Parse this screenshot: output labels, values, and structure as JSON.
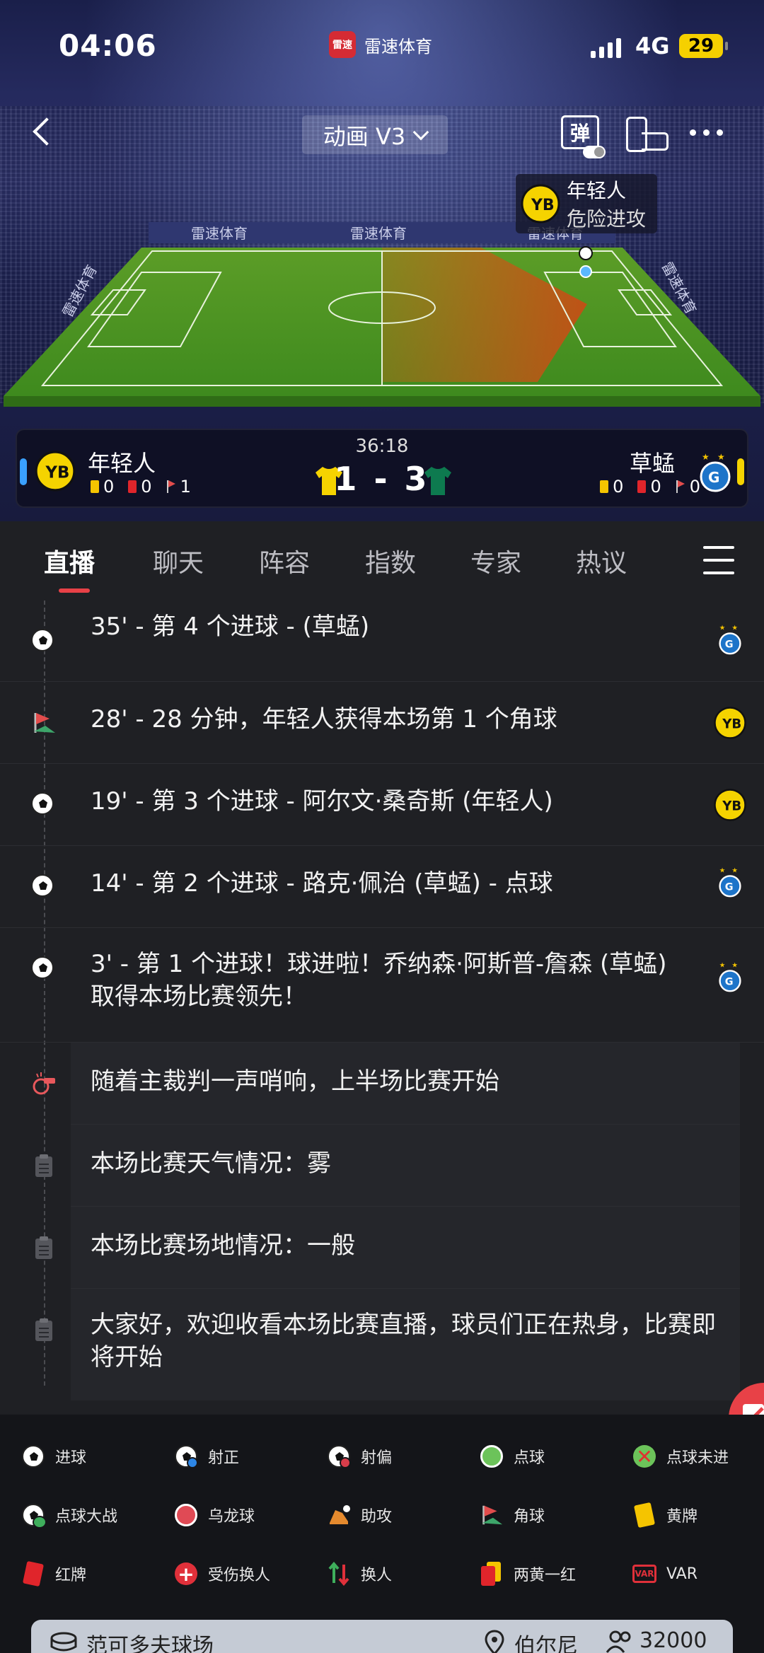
{
  "status_bar": {
    "time": "04:06",
    "app_name": "雷速体育",
    "app_logo_text": "雷速",
    "network": "4G",
    "battery": "29"
  },
  "header": {
    "mode_label": "动画 V3",
    "danmu_label": "弹"
  },
  "event_tip": {
    "team": "年轻人",
    "event": "危险进攻"
  },
  "pitch_ads": [
    "雷速体育",
    "雷速体育",
    "雷速体育",
    "雷速体育",
    "雷速体育"
  ],
  "match": {
    "clock": "36:18",
    "score": "1 - 3",
    "home": {
      "name": "年轻人",
      "yellow": "0",
      "red": "0",
      "corners": "1",
      "color": "#f5d300"
    },
    "away": {
      "name": "草蜢",
      "yellow": "0",
      "red": "0",
      "corners": "0",
      "color": "#0d7a4f"
    }
  },
  "tabs": [
    "直播",
    "聊天",
    "阵容",
    "指数",
    "专家",
    "热议"
  ],
  "feed": [
    {
      "type": "goal",
      "text": "35' - 第 4 个进球 - (草蜢)",
      "team": "away"
    },
    {
      "type": "corner",
      "text": "28' - 28 分钟，年轻人获得本场第 1 个角球",
      "team": "home"
    },
    {
      "type": "goal",
      "text": "19' - 第 3 个进球 - 阿尔文·桑奇斯 (年轻人)",
      "team": "home"
    },
    {
      "type": "goal",
      "text": "14' - 第 2 个进球 - 路克·佩治 (草蜢) - 点球",
      "team": "away"
    },
    {
      "type": "goal",
      "text": "3' - 第 1 个进球！球进啦！乔纳森·阿斯普-詹森 (草蜢) 取得本场比赛领先！",
      "team": "away"
    },
    {
      "type": "whistle",
      "text": "随着主裁判一声哨响，上半场比赛开始"
    },
    {
      "type": "note",
      "text": "本场比赛天气情况：雾"
    },
    {
      "type": "note",
      "text": "本场比赛场地情况：一般"
    },
    {
      "type": "note",
      "text": "大家好，欢迎收看本场比赛直播，球员们正在热身，比赛即将开始"
    }
  ],
  "legend": [
    {
      "icon": "goal-icon",
      "label": "进球"
    },
    {
      "icon": "shot-on-target-icon",
      "label": "射正"
    },
    {
      "icon": "shot-off-target-icon",
      "label": "射偏"
    },
    {
      "icon": "penalty-icon",
      "label": "点球"
    },
    {
      "icon": "penalty-missed-icon",
      "label": "点球未进"
    },
    {
      "icon": "penalty-shootout-icon",
      "label": "点球大战"
    },
    {
      "icon": "own-goal-icon",
      "label": "乌龙球"
    },
    {
      "icon": "assist-icon",
      "label": "助攻"
    },
    {
      "icon": "corner-icon",
      "label": "角球"
    },
    {
      "icon": "yellow-card-icon",
      "label": "黄牌"
    },
    {
      "icon": "red-card-icon",
      "label": "红牌"
    },
    {
      "icon": "injury-sub-icon",
      "label": "受伤换人"
    },
    {
      "icon": "substitution-icon",
      "label": "换人"
    },
    {
      "icon": "second-yellow-red-icon",
      "label": "两黄一红"
    },
    {
      "icon": "var-icon",
      "label": "VAR"
    }
  ],
  "venue": {
    "stadium": "范可多夫球场",
    "city": "伯尔尼",
    "capacity": "32000"
  },
  "colors": {
    "accent": "#e84147",
    "home_badge": "#f5d300",
    "away_badge": "#1d74c9"
  }
}
